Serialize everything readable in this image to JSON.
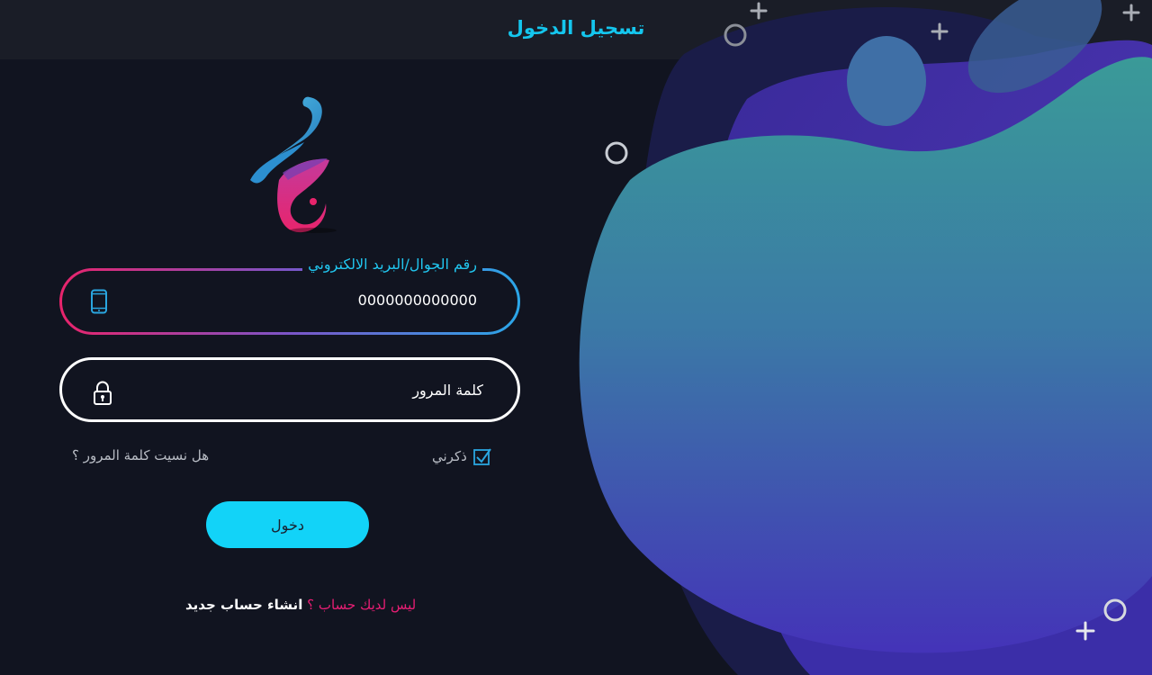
{
  "header": {
    "title": "تسجيل الدخول"
  },
  "form": {
    "phone_field": {
      "label": "رقم الجوال/البريد الالكتروني",
      "value": "0000000000000",
      "icon": "mobile-phone-icon"
    },
    "password_field": {
      "placeholder": "كلمة المرور",
      "icon": "padlock-icon"
    },
    "remember_me": {
      "label": "ذكرني",
      "checked": true
    },
    "forgot_password": "هل نسيت كلمة المرور ؟",
    "login_button": "دخول",
    "signup": {
      "question": "ليس لديك حساب ؟",
      "link": "انشاء حساب جديد"
    }
  },
  "colors": {
    "accent": "#12d3f8",
    "brand_pink": "#e81e74",
    "background": "#111420",
    "header_bg": "#1a1d27"
  }
}
